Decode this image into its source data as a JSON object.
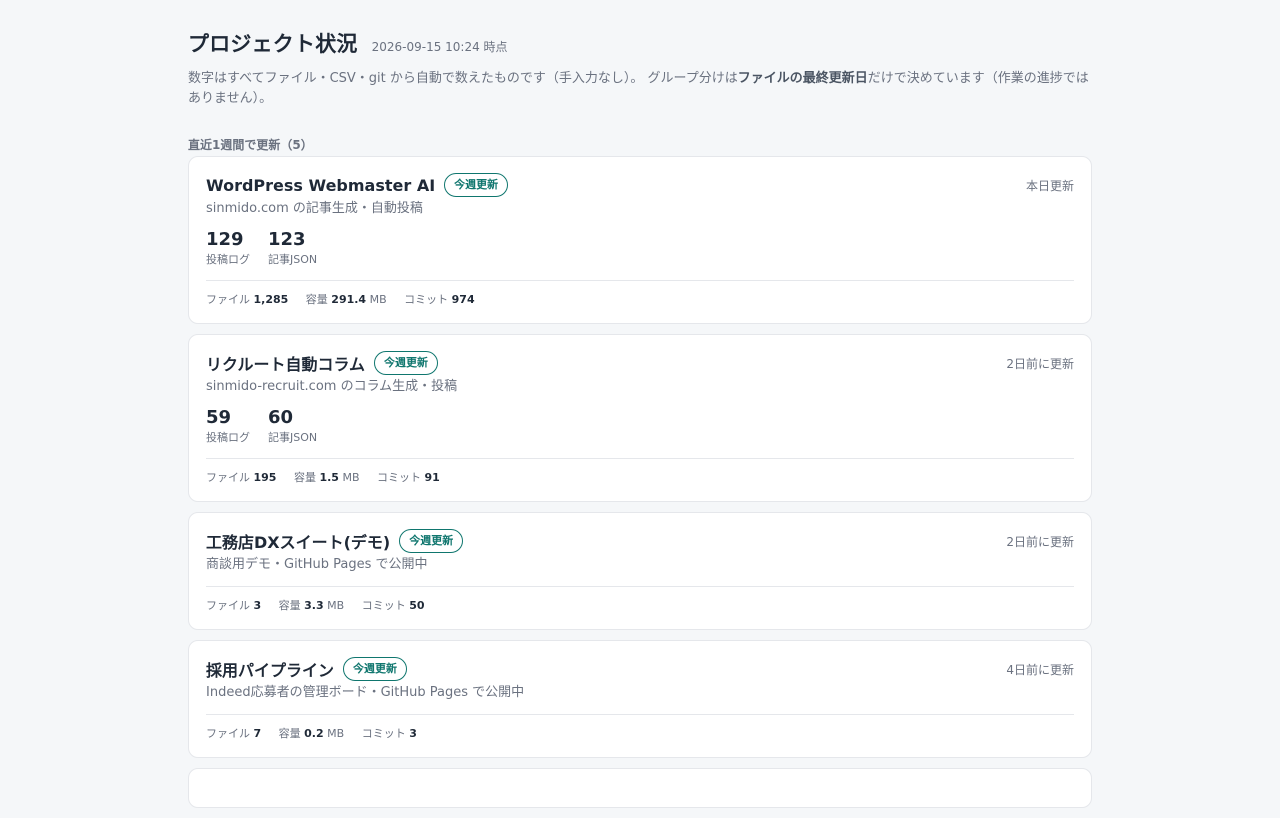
{
  "header": {
    "title": "プロジェクト状況",
    "timestamp": "2026-09-15 10:24 時点",
    "description_pre": "数字はすべてファイル・CSV・git から自動で数えたものです（手入力なし）。 グループ分けは",
    "description_bold": "ファイルの最終更新日",
    "description_post": "だけで決めています（作業の進捗ではありません）。"
  },
  "section": {
    "heading": "直近1週間で更新（5）"
  },
  "cards": [
    {
      "title": "WordPress Webmaster AI",
      "badge": "今週更新",
      "updated": "本日更新",
      "subtitle": "sinmido.com の記事生成・自動投稿",
      "metrics": [
        {
          "value": "129",
          "label": "投稿ログ"
        },
        {
          "value": "123",
          "label": "記事JSON"
        }
      ],
      "stats": {
        "files_label": "ファイル",
        "files": "1,285",
        "size_label": "容量",
        "size": "291.4",
        "size_unit": "MB",
        "commits_label": "コミット",
        "commits": "974"
      }
    },
    {
      "title": "リクルート自動コラム",
      "badge": "今週更新",
      "updated": "2日前に更新",
      "subtitle": "sinmido-recruit.com のコラム生成・投稿",
      "metrics": [
        {
          "value": "59",
          "label": "投稿ログ"
        },
        {
          "value": "60",
          "label": "記事JSON"
        }
      ],
      "stats": {
        "files_label": "ファイル",
        "files": "195",
        "size_label": "容量",
        "size": "1.5",
        "size_unit": "MB",
        "commits_label": "コミット",
        "commits": "91"
      }
    },
    {
      "title": "工務店DXスイート(デモ)",
      "badge": "今週更新",
      "updated": "2日前に更新",
      "subtitle": "商談用デモ・GitHub Pages で公開中",
      "stats": {
        "files_label": "ファイル",
        "files": "3",
        "size_label": "容量",
        "size": "3.3",
        "size_unit": "MB",
        "commits_label": "コミット",
        "commits": "50"
      }
    },
    {
      "title": "採用パイプライン",
      "badge": "今週更新",
      "updated": "4日前に更新",
      "subtitle": "Indeed応募者の管理ボード・GitHub Pages で公開中",
      "stats": {
        "files_label": "ファイル",
        "files": "7",
        "size_label": "容量",
        "size": "0.2",
        "size_unit": "MB",
        "commits_label": "コミット",
        "commits": "3"
      }
    }
  ]
}
